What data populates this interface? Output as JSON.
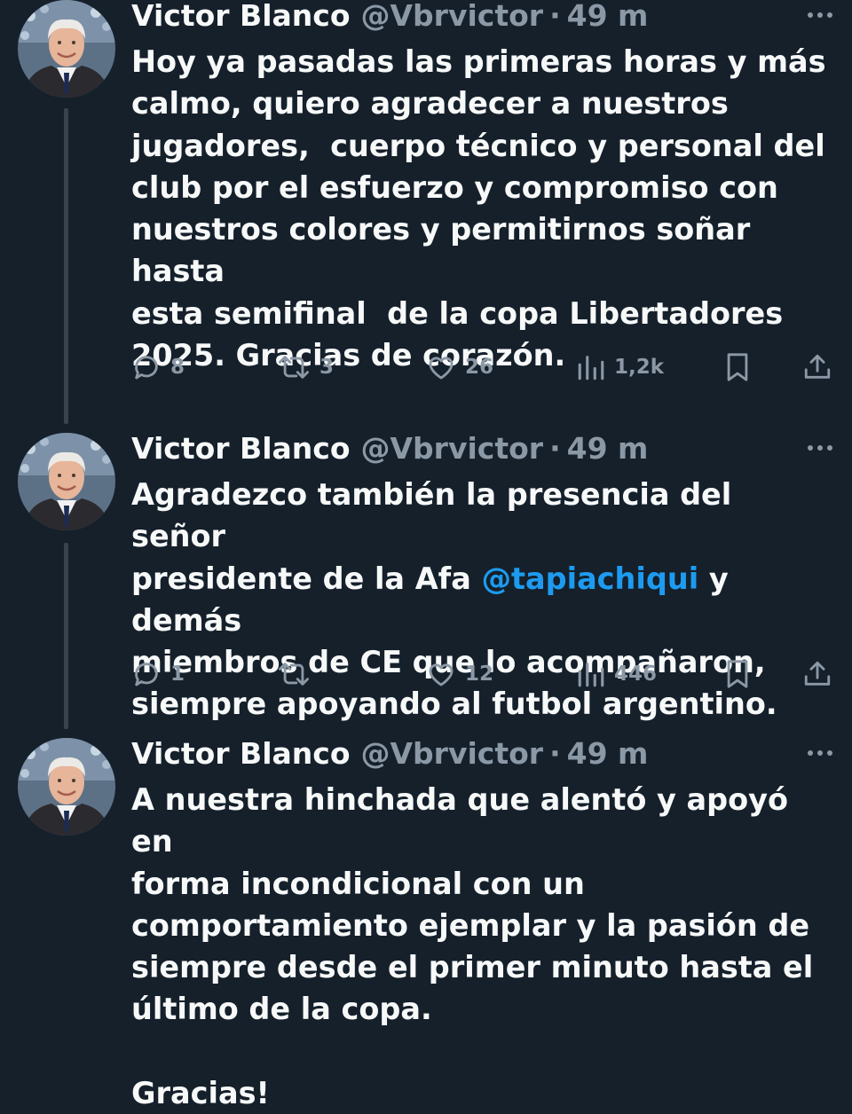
{
  "colors": {
    "background": "#15202b",
    "text": "#f7f9f9",
    "secondary": "#8b98a5",
    "mention": "#1d9bf0",
    "thread_line": "#38444d"
  },
  "tweets": [
    {
      "name": "Victor Blanco",
      "handle": "@Vbrvictor",
      "separator": "·",
      "time": "49 m",
      "text": "Hoy ya pasadas las primeras horas y más\ncalmo, quiero agradecer a nuestros\njugadores,  cuerpo técnico y personal del\nclub por el esfuerzo y compromiso con\nnuestros colores y permitirnos soñar hasta\nesta semifinal  de la copa Libertadores\n2025. Gracias de corazón.",
      "replies": "8",
      "retweets": "3",
      "likes": "26",
      "views": "1,2k"
    },
    {
      "name": "Victor Blanco",
      "handle": "@Vbrvictor",
      "separator": "·",
      "time": "49 m",
      "text_before": "Agradezco también la presencia del señor\npresidente de la Afa ",
      "mention": "@tapiachiqui",
      "text_after": " y demás\nmiembros de CE que lo acompañaron,\nsiempre apoyando al futbol argentino.",
      "replies": "1",
      "retweets": "",
      "likes": "12",
      "views": "446"
    },
    {
      "name": "Victor Blanco",
      "handle": "@Vbrvictor",
      "separator": "·",
      "time": "49 m",
      "text": "A nuestra hinchada que alentó y apoyó en\nforma incondicional con un\ncomportamiento ejemplar y la pasión de\nsiempre desde el primer minuto hasta el\núltimo de la copa.\n\nGracias!"
    }
  ]
}
